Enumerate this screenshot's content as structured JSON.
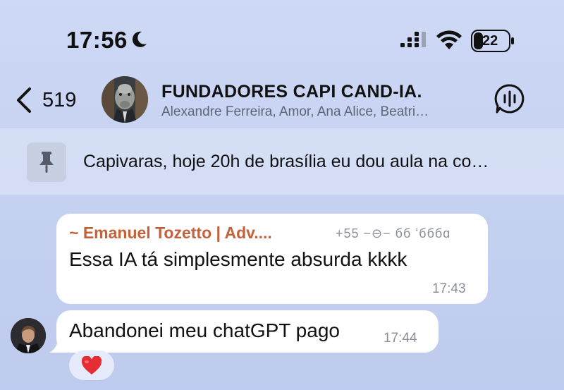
{
  "status_bar": {
    "time": "17:56",
    "battery": "22",
    "icons": [
      "moon-icon",
      "cellular-signal-icon",
      "wifi-icon",
      "battery-icon"
    ]
  },
  "header": {
    "back_count": "519",
    "title": "FUNDADORES CAPI CAND-IA.",
    "members": "Alexandre Ferreira, Amor, Ana Alice, Beatri…"
  },
  "pinned": {
    "text": "Capivaras, hoje 20h de brasília eu dou aula na co…"
  },
  "messages": [
    {
      "sender": "~ Emanuel Tozetto | Adv....",
      "phone": "+55 −⊖− бб    ʻбббɑ",
      "text": "Essa IA tá simplesmente absurda kkkk",
      "time": "17:43"
    },
    {
      "text": "Abandonei meu chatGPT pago",
      "time": "17:44",
      "reaction": "❤️"
    }
  ],
  "colors": {
    "background": "#c6d2f1",
    "sender_name": "#c4603a",
    "timestamp": "#8a8f98",
    "pinned_bar": "#d6dff6",
    "reaction_heart": "#e52d33"
  }
}
